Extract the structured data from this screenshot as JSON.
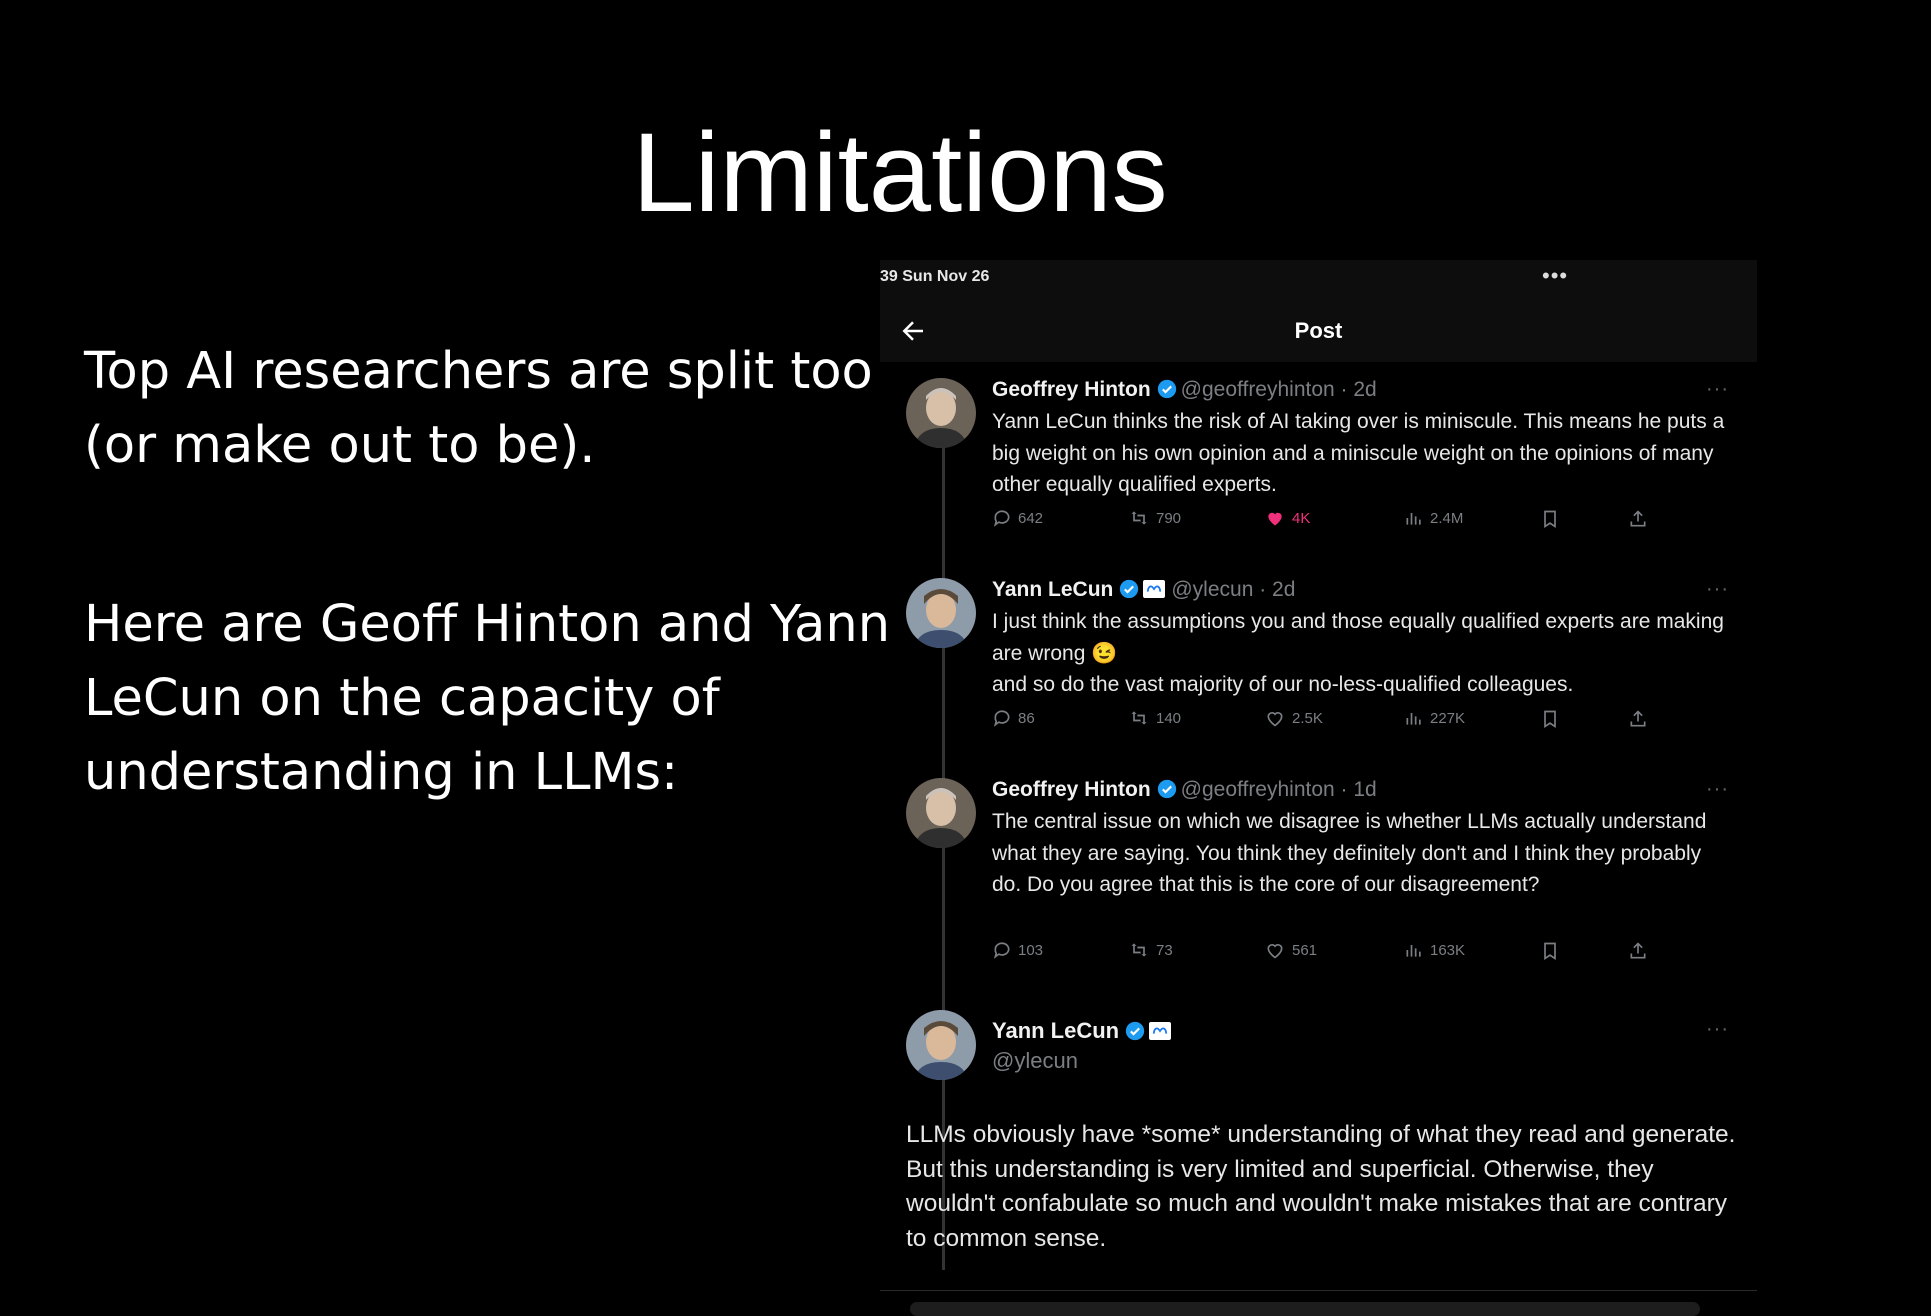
{
  "slide": {
    "title": "Limitations",
    "paragraph1": "Top AI researchers are split too (or make out to be).",
    "paragraph2": "Here are Geoff Hinton and Yann LeCun on the capacity of understanding in LLMs:"
  },
  "phone": {
    "status_time": "39  Sun Nov 26",
    "status_dots": "•••",
    "nav_title": "Post",
    "icons": [
      "back-arrow-icon",
      "verified-icon",
      "meta-logo-icon",
      "reply-icon",
      "repost-icon",
      "like-icon",
      "views-icon",
      "bookmark-icon",
      "share-icon",
      "more-icon"
    ],
    "colors": {
      "verified": "#1d9bf0",
      "liked": "#f0307a",
      "muted": "#7b7f84"
    }
  },
  "tweets": [
    {
      "name": "Geoffrey Hinton",
      "handle": "@geoffreyhinton · 2d",
      "text": "Yann LeCun thinks the risk of AI taking over is miniscule. This means he puts a big weight on his own opinion and a miniscule weight on the opinions of many other equally qualified experts.",
      "replies": "642",
      "reposts": "790",
      "likes": "4K",
      "views": "2.4M",
      "liked": true
    },
    {
      "name": "Yann LeCun",
      "handle": "@ylecun · 2d",
      "text": "I just think the assumptions you and those equally qualified experts are making are wrong 😉\nand so do the vast majority of our no-less-qualified colleagues.",
      "replies": "86",
      "reposts": "140",
      "likes": "2.5K",
      "views": "227K",
      "liked": false
    },
    {
      "name": "Geoffrey Hinton",
      "handle": "@geoffreyhinton · 1d",
      "text": "The central issue on which we disagree is whether LLMs actually understand what they are saying. You think they definitely don't and I think they probably do. Do you agree that this is the core of our disagreement?",
      "replies": "103",
      "reposts": "73",
      "likes": "561",
      "views": "163K",
      "liked": false
    }
  ],
  "main_tweet": {
    "name": "Yann LeCun",
    "handle": "@ylecun",
    "text_line1": "LLMs obviously have *some* understanding of what they read and generate.",
    "text_line2": "But this understanding is very limited and superficial. Otherwise, they wouldn't confabulate so much and wouldn't make mistakes that are contrary to common sense."
  }
}
